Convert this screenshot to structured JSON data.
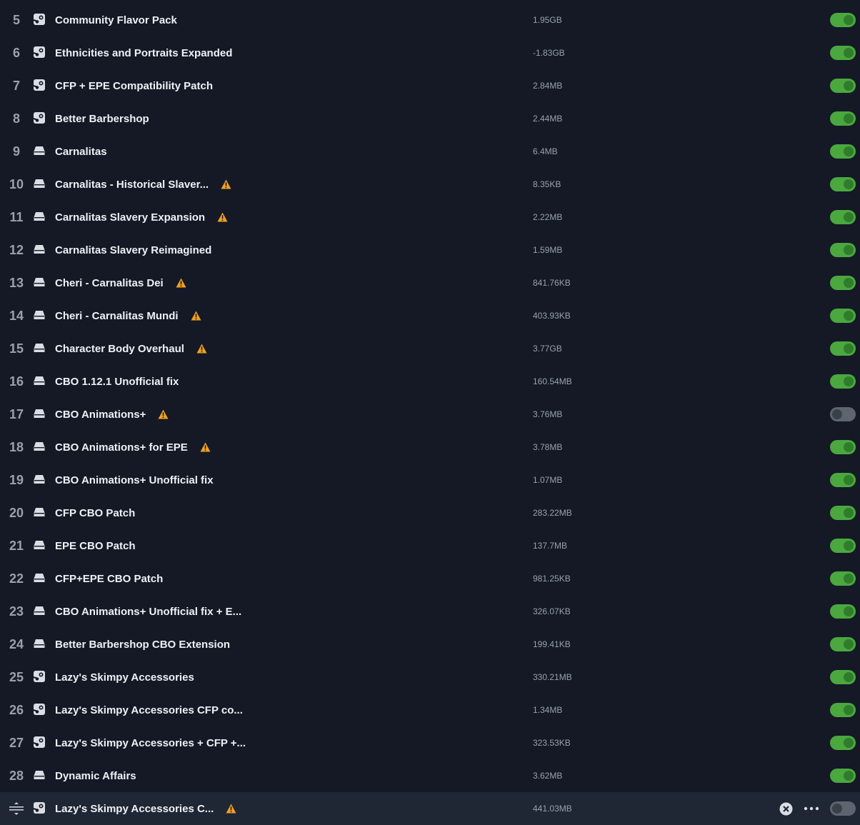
{
  "colors": {
    "background": "#141925",
    "row_selected": "#1f2634",
    "toggle_on": "#4aa83f",
    "toggle_off": "#5f6570",
    "warning": "#f0a020",
    "text": "#eef1f6",
    "muted_text": "#9aa1ad"
  },
  "mods": [
    {
      "index": "5",
      "name": "Community Flavor Pack",
      "size": "1.95GB",
      "source_icon": "steam-icon",
      "warning": false,
      "enabled": true
    },
    {
      "index": "6",
      "name": "Ethnicities and Portraits Expanded",
      "size": "-1.83GB",
      "source_icon": "steam-icon",
      "warning": false,
      "enabled": true
    },
    {
      "index": "7",
      "name": "CFP + EPE Compatibility Patch",
      "size": "2.84MB",
      "source_icon": "steam-icon",
      "warning": false,
      "enabled": true
    },
    {
      "index": "8",
      "name": "Better Barbershop",
      "size": "2.44MB",
      "source_icon": "steam-icon",
      "warning": false,
      "enabled": true
    },
    {
      "index": "9",
      "name": "Carnalitas",
      "size": "6.4MB",
      "source_icon": "local-drive-icon",
      "warning": false,
      "enabled": true
    },
    {
      "index": "10",
      "name": "Carnalitas - Historical Slaver...",
      "size": "8.35KB",
      "source_icon": "local-drive-icon",
      "warning": true,
      "enabled": true
    },
    {
      "index": "11",
      "name": "Carnalitas Slavery Expansion",
      "size": "2.22MB",
      "source_icon": "local-drive-icon",
      "warning": true,
      "enabled": true
    },
    {
      "index": "12",
      "name": "Carnalitas Slavery Reimagined",
      "size": "1.59MB",
      "source_icon": "local-drive-icon",
      "warning": false,
      "enabled": true
    },
    {
      "index": "13",
      "name": "Cheri - Carnalitas Dei",
      "size": "841.76KB",
      "source_icon": "local-drive-icon",
      "warning": true,
      "enabled": true
    },
    {
      "index": "14",
      "name": "Cheri - Carnalitas Mundi",
      "size": "403.93KB",
      "source_icon": "local-drive-icon",
      "warning": true,
      "enabled": true
    },
    {
      "index": "15",
      "name": "Character Body Overhaul",
      "size": "3.77GB",
      "source_icon": "local-drive-icon",
      "warning": true,
      "enabled": true
    },
    {
      "index": "16",
      "name": "CBO 1.12.1 Unofficial fix",
      "size": "160.54MB",
      "source_icon": "local-drive-icon",
      "warning": false,
      "enabled": true
    },
    {
      "index": "17",
      "name": "CBO Animations+",
      "size": "3.76MB",
      "source_icon": "local-drive-icon",
      "warning": true,
      "enabled": false
    },
    {
      "index": "18",
      "name": "CBO Animations+ for EPE",
      "size": "3.78MB",
      "source_icon": "local-drive-icon",
      "warning": true,
      "enabled": true
    },
    {
      "index": "19",
      "name": "CBO Animations+ Unofficial fix",
      "size": "1.07MB",
      "source_icon": "local-drive-icon",
      "warning": false,
      "enabled": true
    },
    {
      "index": "20",
      "name": "CFP CBO Patch",
      "size": "283.22MB",
      "source_icon": "local-drive-icon",
      "warning": false,
      "enabled": true
    },
    {
      "index": "21",
      "name": "EPE CBO Patch",
      "size": "137.7MB",
      "source_icon": "local-drive-icon",
      "warning": false,
      "enabled": true
    },
    {
      "index": "22",
      "name": "CFP+EPE CBO Patch",
      "size": "981.25KB",
      "source_icon": "local-drive-icon",
      "warning": false,
      "enabled": true
    },
    {
      "index": "23",
      "name": "CBO Animations+ Unofficial fix + E...",
      "size": "326.07KB",
      "source_icon": "local-drive-icon",
      "warning": false,
      "enabled": true
    },
    {
      "index": "24",
      "name": "Better Barbershop CBO Extension",
      "size": "199.41KB",
      "source_icon": "local-drive-icon",
      "warning": false,
      "enabled": true
    },
    {
      "index": "25",
      "name": "Lazy's Skimpy Accessories",
      "size": "330.21MB",
      "source_icon": "steam-icon",
      "warning": false,
      "enabled": true
    },
    {
      "index": "26",
      "name": "Lazy's Skimpy Accessories CFP co...",
      "size": "1.34MB",
      "source_icon": "steam-icon",
      "warning": false,
      "enabled": true
    },
    {
      "index": "27",
      "name": "Lazy's Skimpy Accessories + CFP +...",
      "size": "323.53KB",
      "source_icon": "steam-icon",
      "warning": false,
      "enabled": true
    },
    {
      "index": "28",
      "name": "Dynamic Affairs",
      "size": "3.62MB",
      "source_icon": "local-drive-icon",
      "warning": false,
      "enabled": true
    },
    {
      "index": "",
      "name": "Lazy's Skimpy Accessories C...",
      "size": "441.03MB",
      "source_icon": "steam-icon",
      "warning": true,
      "enabled": false,
      "selected": true
    }
  ]
}
